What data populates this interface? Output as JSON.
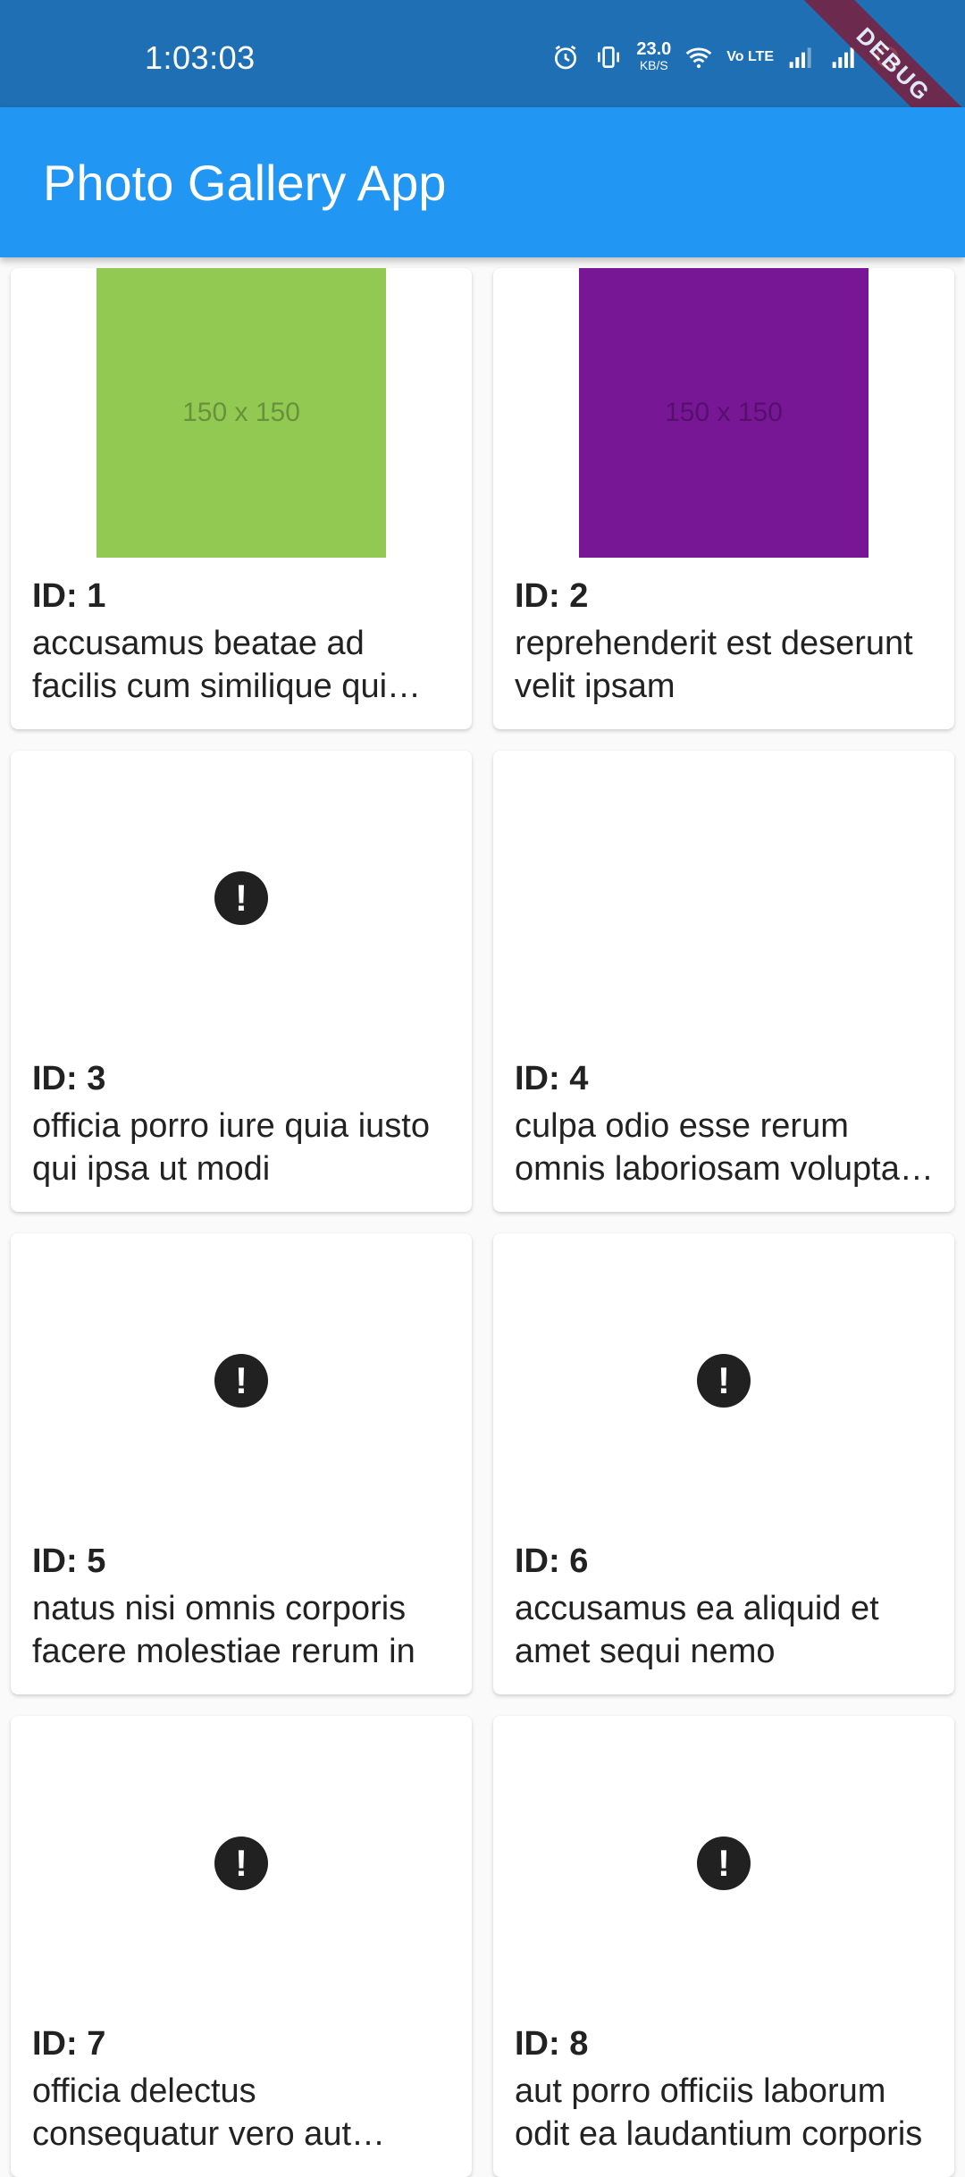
{
  "status_bar": {
    "time": "1:03:03",
    "net_speed_value": "23.0",
    "net_speed_unit": "KB/S",
    "volte": "Vo LTE",
    "icons": [
      "alarm-icon",
      "vibrate-icon",
      "wifi-icon",
      "signal-icon",
      "signal-icon",
      "battery-icon"
    ]
  },
  "debug_banner": "DEBUG",
  "app_bar": {
    "title": "Photo Gallery App",
    "background": "#2196f3"
  },
  "photos": [
    {
      "id_label": "ID: 1",
      "title": "accusamus beatae ad facilis cum similique qui sunt",
      "thumb": "image",
      "thumb_color": "#92c952",
      "thumb_text": "150 x 150"
    },
    {
      "id_label": "ID: 2",
      "title": "reprehenderit est deserunt velit ipsam",
      "thumb": "image",
      "thumb_color": "#771796",
      "thumb_text": "150 x 150"
    },
    {
      "id_label": "ID: 3",
      "title": "officia porro iure quia iusto qui ipsa ut modi",
      "thumb": "error"
    },
    {
      "id_label": "ID: 4",
      "title": "culpa odio esse rerum omnis laboriosam voluptate repudiandae",
      "thumb": "blank"
    },
    {
      "id_label": "ID: 5",
      "title": "natus nisi omnis corporis facere molestiae rerum in",
      "thumb": "error"
    },
    {
      "id_label": "ID: 6",
      "title": "accusamus ea aliquid et amet sequi nemo",
      "thumb": "error"
    },
    {
      "id_label": "ID: 7",
      "title": "officia delectus consequatur vero aut veniam explicabo molestias",
      "thumb": "error"
    },
    {
      "id_label": "ID: 8",
      "title": "aut porro officiis laborum odit ea laudantium corporis",
      "thumb": "error"
    }
  ]
}
